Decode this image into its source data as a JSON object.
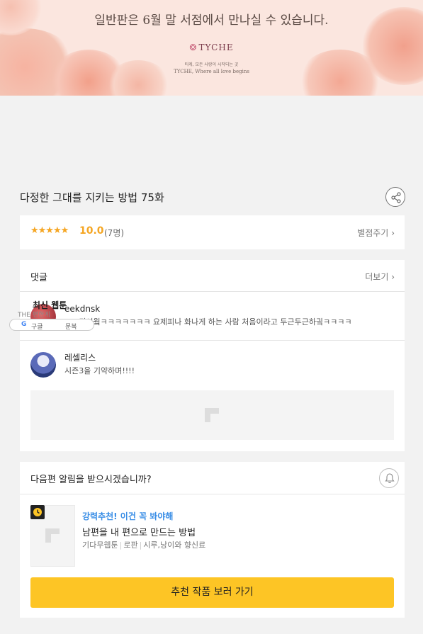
{
  "banner": {
    "title": "일반판은 6월 말 서점에서 만나실 수 있습니다.",
    "logo": "TYCHE",
    "subtitle_ko": "티케, 모든 사랑이 시작되는 곳",
    "subtitle_en": "TYCHE, Where all love begins"
  },
  "episode": {
    "title": "다정한 그대를 지키는 방법 75화"
  },
  "rating": {
    "stars": "★★★★★",
    "score": "10.0",
    "count": "(7명)",
    "rate_link": "별점주기"
  },
  "comments": {
    "title": "댓글",
    "more_link": "더보기",
    "items": [
      {
        "name": "eekdnsk",
        "text": "ㅋㅋ귀여웤ㅋㅋㅋㅋㅋㅋㅋ 요제피나 화나게 하는 사람 처음이라고 두근두근하긬ㅋㅋㅋㅋ"
      },
      {
        "name": "레셀리스",
        "text": "시즌3을 기약하며!!!!"
      }
    ]
  },
  "overlay": {
    "tag": "최신 웹툰",
    "small": "THE 편한게",
    "pill_left": "구글",
    "pill_right": "문북"
  },
  "notify": {
    "title": "다음편 알림을 받으시겠습니까?"
  },
  "recommend": {
    "label": "강력추천! 이건 꼭 봐야해",
    "title": "남편을 내 편으로 만드는 방법",
    "meta_type": "기다무웹툰",
    "meta_genre": "로판",
    "meta_author": "시루,낭이와 향신료",
    "cta": "추천 작품 보러 가기"
  },
  "colors": {
    "accent": "#fdc525",
    "star": "#f5a623",
    "link_blue": "#3a8ee6"
  }
}
